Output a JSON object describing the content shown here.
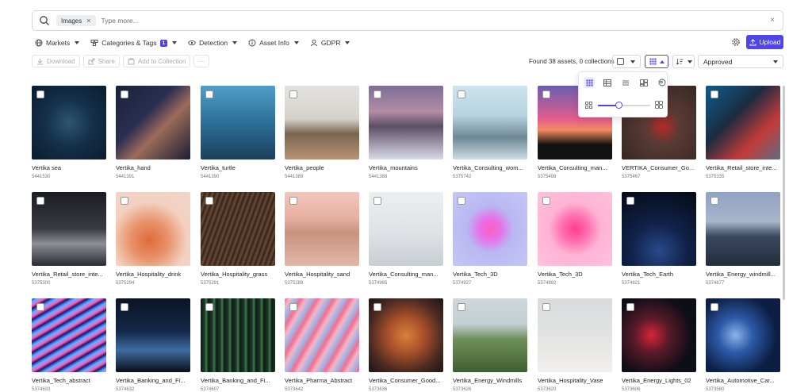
{
  "search": {
    "chip": "Images",
    "placeholder": "Type more...",
    "clear": "×"
  },
  "filters": [
    {
      "label": "Markets",
      "icon": "globe-icon"
    },
    {
      "label": "Categories & Tags",
      "icon": "tags-icon",
      "badge": "1"
    },
    {
      "label": "Detection",
      "icon": "eye-icon"
    },
    {
      "label": "Asset Info",
      "icon": "info-icon"
    },
    {
      "label": "GDPR",
      "icon": "user-icon"
    }
  ],
  "upload_label": "Upload",
  "actions": {
    "download": "Download",
    "share": "Share",
    "add_collection": "Add to Collection",
    "more": "···"
  },
  "found_text": "Found 38 assets, 0 collections",
  "status_value": "Approved",
  "colors": {
    "accent": "#4f46e5"
  },
  "view_slider": {
    "level": 0.4
  },
  "assets": [
    {
      "title": "Vertika sea",
      "id": "5441530",
      "bg": "radial-gradient(circle at 50% 50%, #2f5670 0%, #14304a 45%, #0b1c2e 100%)"
    },
    {
      "title": "Vertika_hand",
      "id": "5441391",
      "bg": "linear-gradient(135deg, #1a2238 0%, #2b2f50 40%, #9b6b5a 60%, #1b1e33 100%)"
    },
    {
      "title": "Vertika_turtle",
      "id": "5441390",
      "bg": "linear-gradient(180deg, #4f9fc8 0%, #2c6f98 50%, #1d3f5c 100%)"
    },
    {
      "title": "Vertika_people",
      "id": "5441389",
      "bg": "linear-gradient(180deg, #e3e2df 0%, #d6d2cb 45%, #7a6450 65%, #b89474 100%)"
    },
    {
      "title": "Vertika_mountains",
      "id": "5441388",
      "bg": "linear-gradient(180deg, #7d6e96 0%, #b48ca6 35%, #5c4e66 55%, #d9dbe8 100%)"
    },
    {
      "title": "Vertika_Consulting_wom...",
      "id": "5375742",
      "bg": "linear-gradient(180deg, #cde3ee 0%, #b7d3e1 40%, #6d8797 70%, #cfdde4 100%)"
    },
    {
      "title": "Vertika_Consulting_man...",
      "id": "5375498",
      "bg": "linear-gradient(180deg, #6a5db0 0%, #e35d8c 45%, #f28b61 60%, #121212 80%)"
    },
    {
      "title": "VERTIKA_Consumer_Go...",
      "id": "5375467",
      "bg": "radial-gradient(circle at 55% 55%, #b82a2a 0%, #5b3a34 30%, #2f2622 100%)"
    },
    {
      "title": "Vertika_Retail_store_inte...",
      "id": "5375335",
      "bg": "linear-gradient(135deg, #0e5d8b 0%, #1b2c40 40%, #c43a3a 70%, #5d6e7f 100%)"
    },
    {
      "title": "Vertika_Retail_store_inte...",
      "id": "5375300",
      "bg": "linear-gradient(180deg, #1b1b22 0%, #3a3a44 50%, #8d8d94 70%, #2a2a31 100%)"
    },
    {
      "title": "Vertika_Hospitality_drink",
      "id": "5375294",
      "bg": "radial-gradient(circle at 45% 65%, #e06a3a 0%, #e8926a 30%, #f3d0c0 60%, #f0d6c8 100%)"
    },
    {
      "title": "Vertika_Hospitality_grass",
      "id": "5375291",
      "bg": "repeating-linear-gradient(110deg, #3e2a20 0px, #6a4a34 3px, #2c1c15 6px)"
    },
    {
      "title": "Vertika_Hospitality_sand",
      "id": "5375289",
      "bg": "linear-gradient(180deg, #f2c6bc 0%, #e8b0a2 35%, #c99280 55%, #e2b7a8 100%)"
    },
    {
      "title": "Vertika_Consulting_man...",
      "id": "5374985",
      "bg": "linear-gradient(180deg, #eceff1 0%, #dfe3e6 55%, #c9ced2 100%)"
    },
    {
      "title": "Vertika_Tech_3D",
      "id": "5374927",
      "bg": "radial-gradient(circle at 50% 50%, #ff5fbf 0%, #e86fe8 20%, #b9b8f3 45%, #c4c7f4 100%)"
    },
    {
      "title": "Vertika_Tech_3D",
      "id": "5374892",
      "bg": "radial-gradient(circle at 50% 50%, #ff3f8c 0%, #ff6fb0 25%, #ffb3d4 50%, #ffc2dc 100%)"
    },
    {
      "title": "Vertika_Tech_Earth",
      "id": "5374821",
      "bg": "radial-gradient(circle at 50% 80%, #2a4a8a 0%, #10224a 40%, #050914 100%)"
    },
    {
      "title": "Vertika_Energy_windmill...",
      "id": "5374677",
      "bg": "linear-gradient(180deg, #8fa3c3 0%, #a8b5cb 40%, #3a4860 60%, #232d3c 100%)"
    },
    {
      "title": "Vertika_Tech_abstract",
      "id": "5374633",
      "bg": "repeating-linear-gradient(150deg, #1d2dbf 0px, #5fb3ff 4px, #ff5fc5 8px, #101040 12px)"
    },
    {
      "title": "Vertika_Banking_and_Fi...",
      "id": "5374632",
      "bg": "linear-gradient(180deg, #0b1424 0%, #14284a 45%, #3d6ca0 70%, #0a0f18 100%)"
    },
    {
      "title": "Vertika_Banking_and_Fi...",
      "id": "5374607",
      "bg": "repeating-linear-gradient(90deg, #0c1a16 0px, #1e3a2a 5px, #3e7a4a 7px, #0c1a16 10px)"
    },
    {
      "title": "Vertika_Pharma_Abstract",
      "id": "5373642",
      "bg": "repeating-linear-gradient(120deg, #f07090 0px, #f3b6c8 6px, #9fb6e8 12px, #f07090 18px)"
    },
    {
      "title": "Vertika_Consumer_Good...",
      "id": "5373636",
      "bg": "radial-gradient(circle at 50% 50%, #d8803a 0%, #a8502a 35%, #4a2a22 70%, #1c1418 100%)"
    },
    {
      "title": "Vertika_Energy_Windmills",
      "id": "5373626",
      "bg": "linear-gradient(180deg, #cfd8dc 0%, #c3cfd3 35%, #6f8f5a 55%, #3e5f33 100%)"
    },
    {
      "title": "Vertika_Hospitality_Vase",
      "id": "5373620",
      "bg": "linear-gradient(180deg, #d9dadc 0%, #e4e4e4 55%, #f1f0ee 100%)"
    },
    {
      "title": "Vertika_Energy_Lights_02",
      "id": "5373606",
      "bg": "radial-gradient(circle at 40% 50%, #d9243a 0%, #5a1a2a 30%, #0e0e16 70%)"
    },
    {
      "title": "Vertika_Automotive_Car...",
      "id": "5373580",
      "bg": "radial-gradient(circle at 40% 50%, #8ab4e8 0%, #2c5aa8 30%, #0d1e44 70%)"
    }
  ]
}
